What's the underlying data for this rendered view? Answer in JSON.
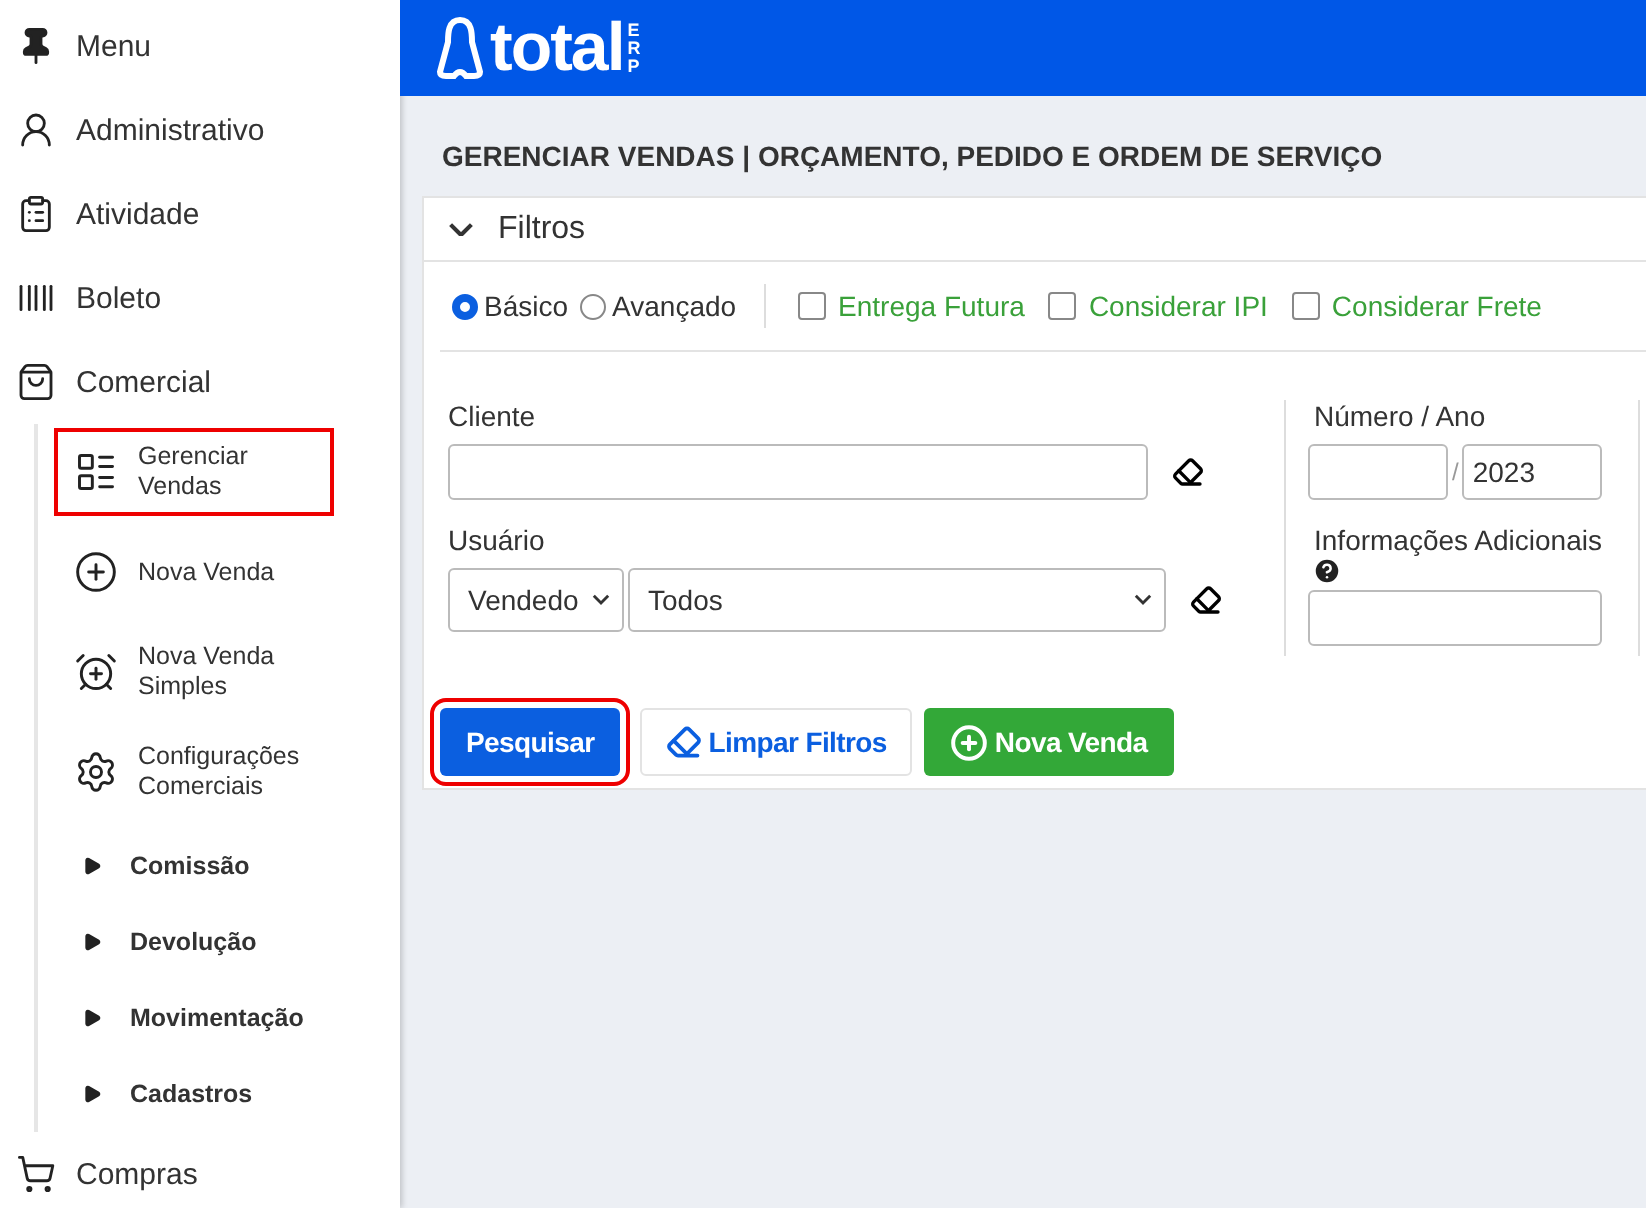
{
  "sidebar": {
    "items": [
      {
        "label": "Menu",
        "kind": "pin"
      },
      {
        "label": "Administrativo",
        "kind": "menu"
      },
      {
        "label": "Atividade",
        "kind": "menu"
      },
      {
        "label": "Boleto",
        "kind": "menu"
      },
      {
        "label": "Comercial",
        "kind": "menu",
        "expanded": true,
        "children": [
          {
            "label": "Gerenciar Vendas",
            "kind": "link",
            "highlighted": true
          },
          {
            "label": "Nova Venda",
            "kind": "link",
            "highlighted": false
          },
          {
            "label": "Nova Venda Simples",
            "kind": "link",
            "highlighted": false
          },
          {
            "label": "Configurações Comerciais",
            "kind": "link",
            "highlighted": false
          },
          {
            "label": "Comissão",
            "kind": "group",
            "expanded": false
          },
          {
            "label": "Devolução",
            "kind": "group",
            "expanded": false
          },
          {
            "label": "Movimentação",
            "kind": "group",
            "expanded": false
          },
          {
            "label": "Cadastros",
            "kind": "group",
            "expanded": false
          }
        ]
      },
      {
        "label": "Compras",
        "kind": "menu"
      }
    ]
  },
  "header": {
    "logo": "total",
    "logo_suffix": "ERP"
  },
  "page_title": "GERENCIAR VENDAS | ORÇAMENTO, PEDIDO E ORDEM DE SERVIÇO",
  "filters": {
    "title": "Filtros",
    "expanded": true,
    "modes": [
      {
        "label": "Básico",
        "selected": true
      },
      {
        "label": "Avançado",
        "selected": false
      }
    ],
    "options": [
      {
        "label": "Entrega Futura",
        "checked": false
      },
      {
        "label": "Considerar IPI",
        "checked": false
      },
      {
        "label": "Considerar Frete",
        "checked": false
      }
    ],
    "cliente": {
      "label": "Cliente"
    },
    "usuario": {
      "label": "Usuário",
      "type": "Vendedo",
      "value": "Todos"
    },
    "numero_ano": {
      "label": "Número / Ano",
      "separator": "/",
      "ano": "2023"
    },
    "info": {
      "label": "Informações Adicionais"
    },
    "buttons": [
      {
        "label": "Pesquisar",
        "kind": "primary",
        "highlighted": true
      },
      {
        "label": "Limpar Filtros",
        "kind": "clear",
        "highlighted": false
      },
      {
        "label": "Nova Venda",
        "kind": "add",
        "highlighted": false
      }
    ]
  }
}
